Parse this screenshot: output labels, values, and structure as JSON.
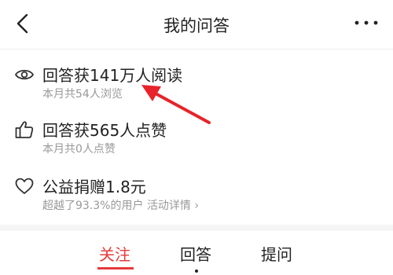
{
  "header": {
    "title": "我的问答",
    "back_icon": "chevron-left-icon",
    "more_icon": "more-horizontal-icon"
  },
  "stats": [
    {
      "icon": "eye-icon",
      "title": "回答获141万人阅读",
      "subtitle": "本月共54人浏览"
    },
    {
      "icon": "thumbs-up-icon",
      "title": "回答获565人点赞",
      "subtitle": "本月共0人点赞"
    },
    {
      "icon": "heart-icon",
      "title": "公益捐赠1.8元",
      "subtitle": "超越了93.3%的用户",
      "link": "活动详情 ›"
    }
  ],
  "tabs": [
    {
      "label": "关注",
      "active": true
    },
    {
      "label": "回答",
      "active": false
    },
    {
      "label": "提问",
      "active": false
    }
  ],
  "colors": {
    "accent": "#e63b3b",
    "secondary_text": "#999999",
    "primary_text": "#222222"
  }
}
